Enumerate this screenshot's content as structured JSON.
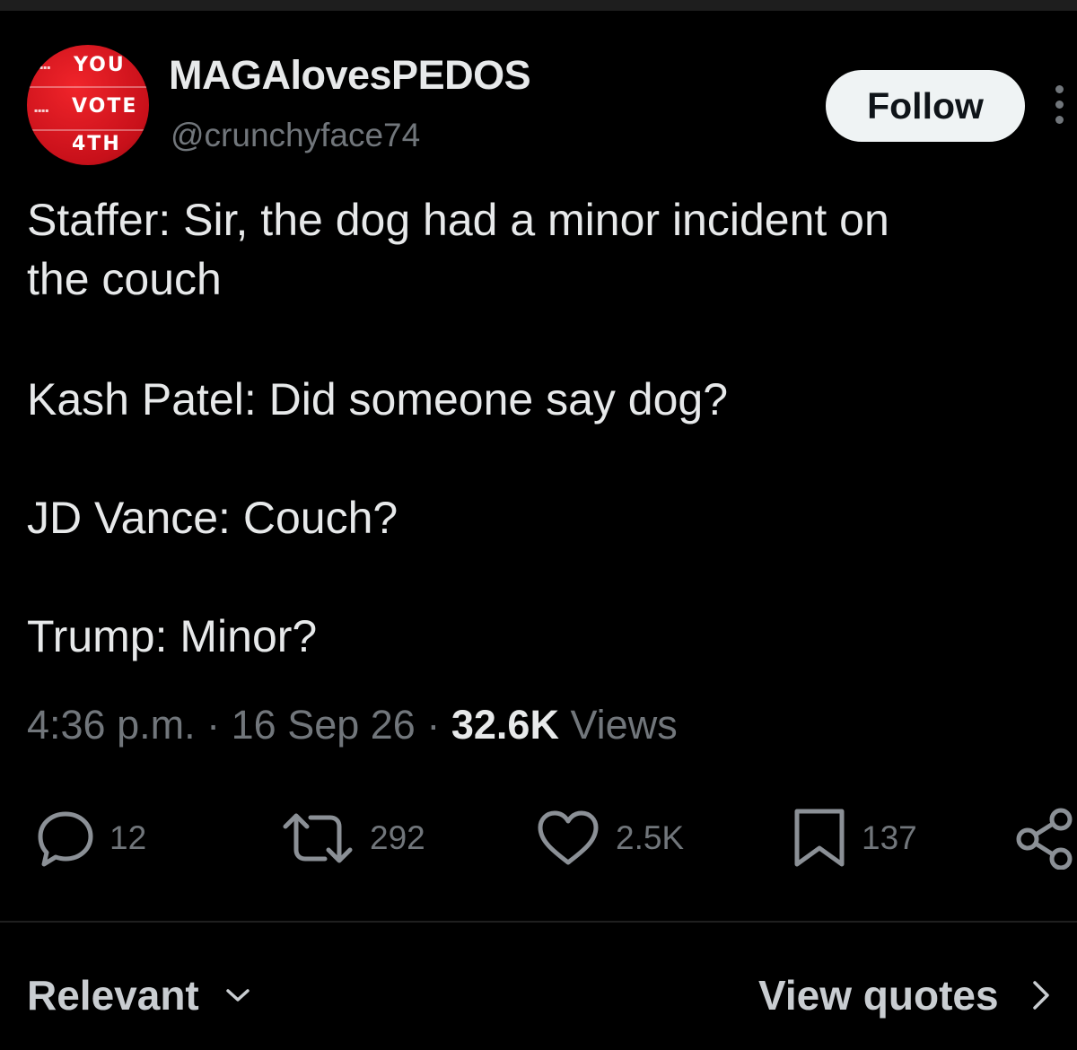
{
  "author": {
    "display_name": "MAGAlovesPEDOS",
    "handle": "@crunchyface74",
    "avatar_text": [
      "YOU",
      "VOTE",
      "4TH"
    ],
    "avatar_color": "#d7141c"
  },
  "follow_label": "Follow",
  "tweet": {
    "lines": [
      "Staffer: Sir, the dog had a minor incident on",
      "the couch",
      "Kash Patel: Did someone say dog?",
      "JD Vance: Couch?",
      "Trump: Minor?"
    ]
  },
  "meta": {
    "time": "4:36 p.m.",
    "sep": "·",
    "date": "16 Sep 26",
    "views_count": "32.6K",
    "views_label": "Views"
  },
  "actions": {
    "replies": "12",
    "reposts": "292",
    "likes": "2.5K",
    "bookmarks": "137"
  },
  "footer": {
    "sort_label": "Relevant",
    "quotes_label": "View quotes"
  },
  "icons": {
    "reply": "speech-bubble",
    "repost": "repost-arrows",
    "like": "heart",
    "bookmark": "bookmark",
    "share": "share-nodes",
    "more": "vertical-dots"
  }
}
